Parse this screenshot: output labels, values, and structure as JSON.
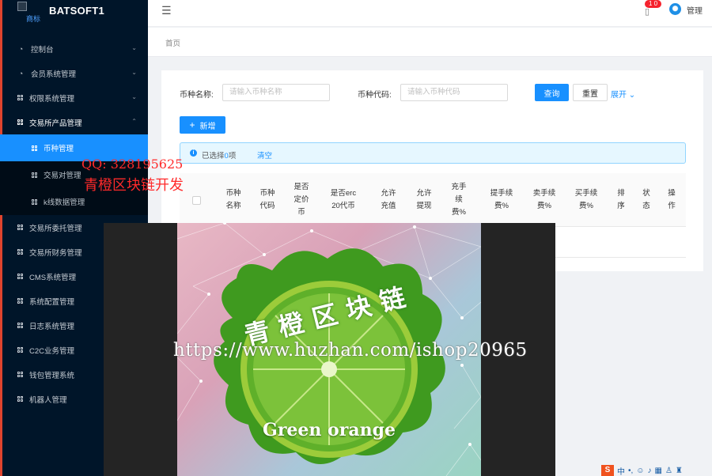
{
  "app": {
    "logo_alt": "商标",
    "title": "BATSOFT1"
  },
  "header": {
    "menu_icon": "hamburger-icon",
    "notification_count": "1 0",
    "user_name": "管理"
  },
  "sidebar": {
    "items": [
      {
        "label": "控制台",
        "icon": "dashboard-icon"
      },
      {
        "label": "会员系统管理",
        "icon": "dashboard-icon"
      },
      {
        "label": "权限系统管理",
        "icon": "grid-icon"
      },
      {
        "label": "交易所产品管理",
        "icon": "grid-icon"
      },
      {
        "label": "交易所委托管理",
        "icon": "grid-icon"
      },
      {
        "label": "交易所财务管理",
        "icon": "grid-icon"
      },
      {
        "label": "CMS系统管理",
        "icon": "grid-icon"
      },
      {
        "label": "系统配置管理",
        "icon": "grid-icon"
      },
      {
        "label": "日志系统管理",
        "icon": "grid-icon"
      },
      {
        "label": "C2C业务管理",
        "icon": "grid-icon"
      },
      {
        "label": "钱包管理系统",
        "icon": "grid-icon"
      },
      {
        "label": "机器人管理",
        "icon": "grid-icon"
      }
    ],
    "sub_items": [
      {
        "label": "币种管理"
      },
      {
        "label": "交易对管理"
      },
      {
        "label": "k线数据管理"
      }
    ]
  },
  "breadcrumb": {
    "home": "首页"
  },
  "search": {
    "name_label": "币种名称:",
    "name_placeholder": "请输入币种名称",
    "code_label": "币种代码:",
    "code_placeholder": "请输入币种代码",
    "query_button": "查询",
    "reset_button": "重置",
    "expand_link": "展开"
  },
  "toolbar": {
    "add_button": "新增"
  },
  "alert": {
    "selected_prefix": "已选择",
    "selected_count": "0",
    "selected_suffix": "项",
    "clear_link": "清空"
  },
  "table": {
    "columns": [
      "币种\n名称",
      "币种\n代码",
      "是否\n定价\n币",
      "是否erc\n20代币",
      "允许\n充值",
      "允许\n提现",
      "充手\n续\n费%",
      "提手续\n费%",
      "卖手续\n费%",
      "买手续\n费%",
      "排\n序",
      "状\n态",
      "操\n作"
    ]
  },
  "watermarks": {
    "qq": "QQ: 328195625",
    "developer": "青橙区块链开发",
    "poster_title": "青橙区块链",
    "poster_subtitle": "Green orange",
    "url": "https://www.huzhan.com/ishop20965"
  },
  "tray": {
    "ime_logo": "S",
    "ime_lang": "中"
  },
  "colors": {
    "sidebar_bg": "#001529",
    "primary": "#1890ff",
    "active_item": "#1890ff",
    "badge": "#f5222d",
    "watermark_red": "#ff2a2a"
  }
}
